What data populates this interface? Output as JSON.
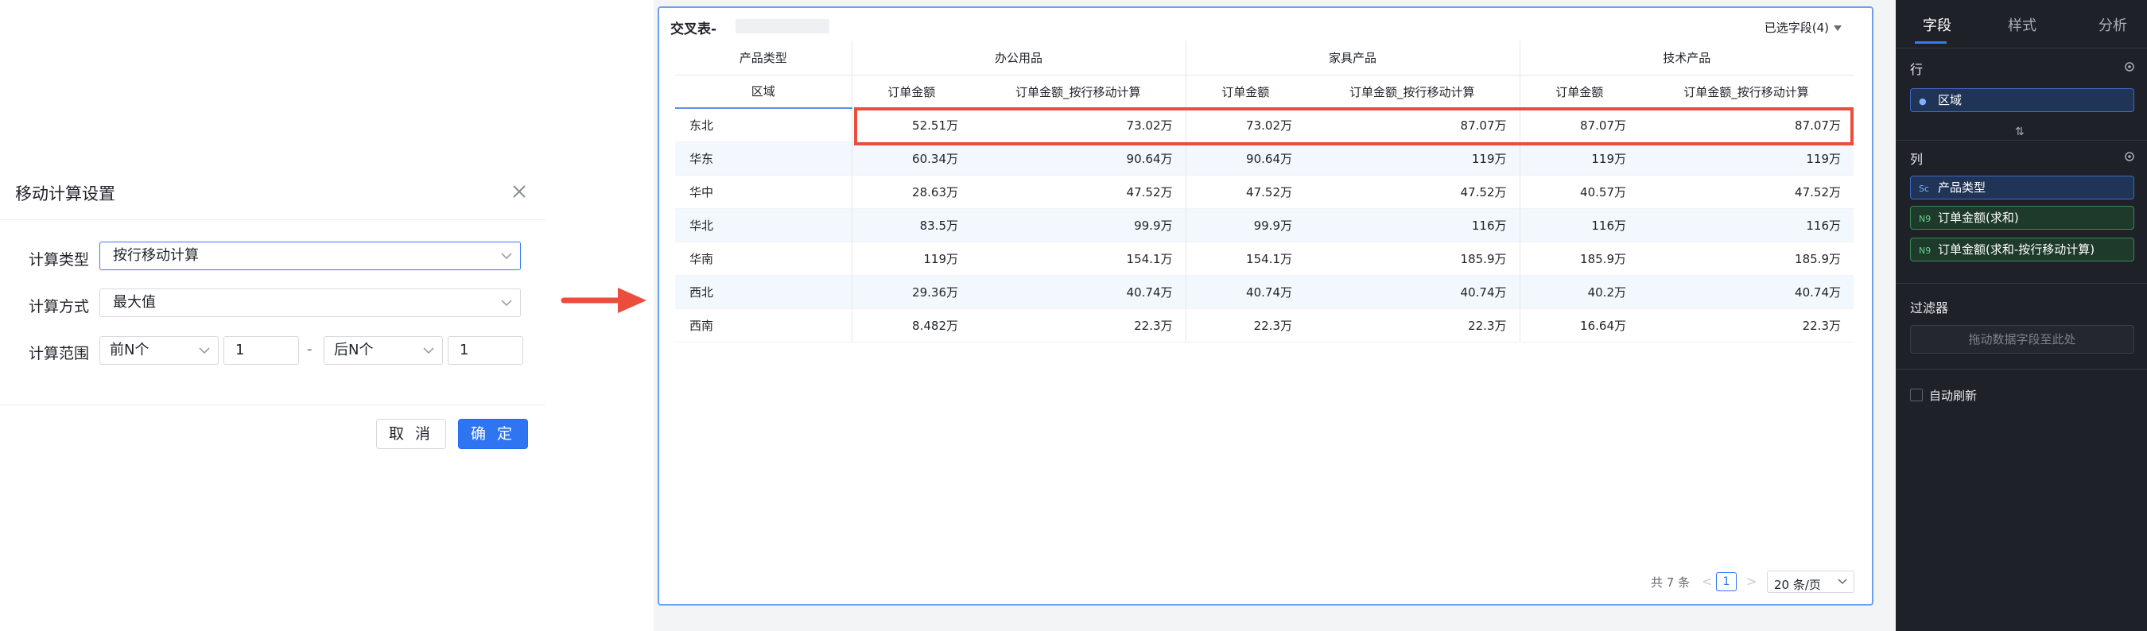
{
  "dialog": {
    "title": "移动计算设置",
    "calc_type_label": "计算类型",
    "calc_type_value": "按行移动计算",
    "calc_method_label": "计算方式",
    "calc_method_value": "最大值",
    "calc_range_label": "计算范围",
    "range_start_select": "前N个",
    "range_start_value": "1",
    "range_separator": "-",
    "range_end_select": "后N个",
    "range_end_value": "1",
    "cancel_label": "取 消",
    "ok_label": "确 定"
  },
  "table_panel": {
    "title": "交叉表-",
    "fields_selected": "已选字段(4)",
    "row_dim_header": "产品类型",
    "row_dim_sub": "区域",
    "groups": [
      "办公用品",
      "家具产品",
      "技术产品"
    ],
    "measures": [
      "订单金额",
      "订单金额_按行移动计算"
    ],
    "rows": [
      {
        "area": "东北",
        "values": [
          "52.51万",
          "73.02万",
          "73.02万",
          "87.07万",
          "87.07万",
          "87.07万"
        ]
      },
      {
        "area": "华东",
        "values": [
          "60.34万",
          "90.64万",
          "90.64万",
          "119万",
          "119万",
          "119万"
        ]
      },
      {
        "area": "华中",
        "values": [
          "28.63万",
          "47.52万",
          "47.52万",
          "47.52万",
          "40.57万",
          "47.52万"
        ]
      },
      {
        "area": "华北",
        "values": [
          "83.5万",
          "99.9万",
          "99.9万",
          "116万",
          "116万",
          "116万"
        ]
      },
      {
        "area": "华南",
        "values": [
          "119万",
          "154.1万",
          "154.1万",
          "185.9万",
          "185.9万",
          "185.9万"
        ]
      },
      {
        "area": "西北",
        "values": [
          "29.36万",
          "40.74万",
          "40.74万",
          "40.74万",
          "40.2万",
          "40.74万"
        ]
      },
      {
        "area": "西南",
        "values": [
          "8.482万",
          "22.3万",
          "22.3万",
          "22.3万",
          "16.64万",
          "22.3万"
        ]
      }
    ],
    "pager": {
      "total": "共 7 条",
      "current_page": "1",
      "page_size": "20 条/页",
      "prev": "<",
      "next": ">"
    }
  },
  "sidebar": {
    "tabs": [
      "字段",
      "样式",
      "分析"
    ],
    "active_tab": "字段",
    "row_section": "行",
    "row_fields": [
      {
        "icon": "geo-icon",
        "label": "区域"
      }
    ],
    "swap_glyph": "⇅",
    "col_section": "列",
    "col_fields": [
      {
        "icon": "dim-icon",
        "glyph": "Sc",
        "label": "产品类型",
        "kind": "dimension"
      },
      {
        "icon": "measure-icon",
        "glyph": "N9",
        "label": "订单金额(求和)",
        "kind": "measure"
      },
      {
        "icon": "measure-icon",
        "glyph": "N9",
        "label": "订单金额(求和-按行移动计算)",
        "kind": "measure"
      }
    ],
    "filter_section": "过滤器",
    "filter_placeholder": "拖动数据字段至此处",
    "auto_refresh_label": "自动刷新"
  },
  "colors": {
    "primary": "#2f74f1",
    "highlight_border": "#ea4d3b",
    "arrow": "#ea4d3b",
    "sidebar_bg": "#1e2127"
  }
}
